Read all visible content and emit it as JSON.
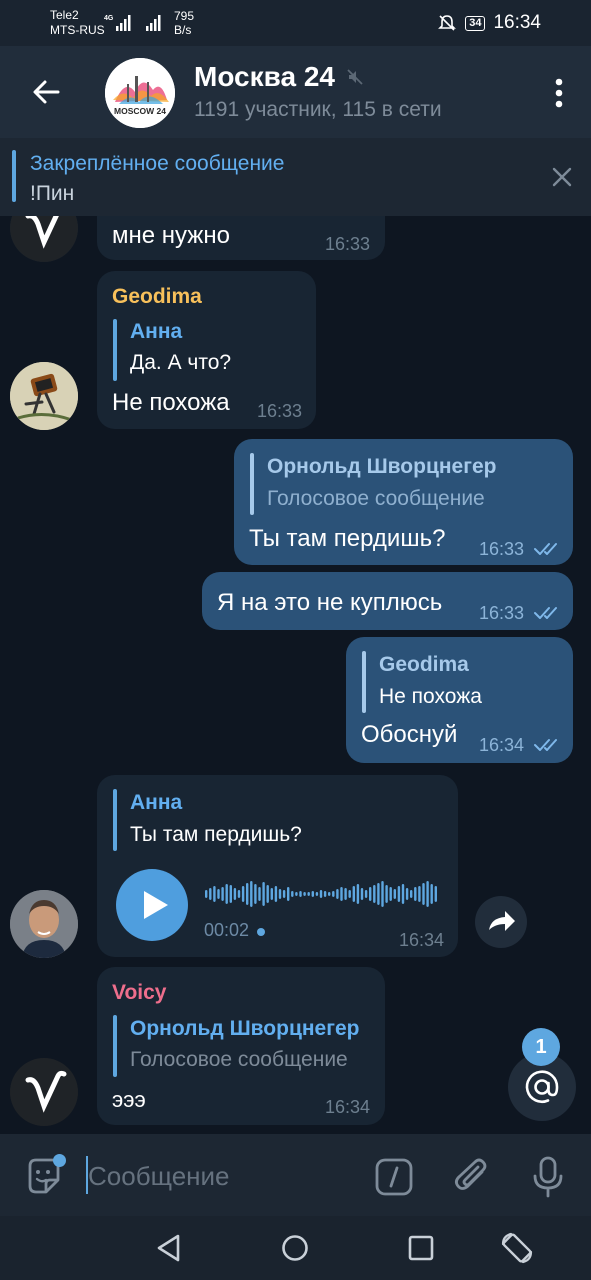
{
  "status_bar": {
    "carrier1": "Tele2",
    "carrier2": "MTS-RUS",
    "net_type": "4G",
    "speed_value": "795",
    "speed_unit": "B/s",
    "battery": "34",
    "time": "16:34"
  },
  "header": {
    "title": "Москва 24",
    "subtitle": "1191 участник, 115 в сети",
    "logo_text": "MOSCOW 24"
  },
  "pinned": {
    "title": "Закреплённое сообщение",
    "text": "!Пин"
  },
  "messages": [
    {
      "direction": "in",
      "text": "мне нужно",
      "time": "16:33"
    },
    {
      "direction": "in",
      "sender": "Geodima",
      "reply_name": "Анна",
      "reply_text": "Да. А что?",
      "text": "Не похожа",
      "time": "16:33"
    },
    {
      "direction": "out",
      "reply_name": "Орнольд Шворцнегер",
      "reply_text": "Голосовое сообщение",
      "text": "Ты там пердишь?",
      "time": "16:33"
    },
    {
      "direction": "out",
      "text": "Я на это не куплюсь",
      "time": "16:33"
    },
    {
      "direction": "out",
      "reply_name": "Geodima",
      "reply_text": "Не похожа",
      "text": "Обоснуй",
      "time": "16:34"
    },
    {
      "direction": "in",
      "reply_name": "Анна",
      "reply_text": "Ты там пердишь?",
      "voice_duration": "00:02",
      "time": "16:34"
    },
    {
      "direction": "in",
      "sender": "Voicy",
      "reply_name": "Орнольд Шворцнегер",
      "reply_text": "Голосовое сообщение",
      "text": "эээ",
      "time": "16:34"
    }
  ],
  "mention_badge": "1",
  "input": {
    "placeholder": "Сообщение"
  },
  "colors": {
    "accent": "#5ea7e0",
    "incoming": "#182533",
    "outgoing": "#2b5278",
    "geodima": "#f7c05b",
    "voicy": "#ee6e8c"
  }
}
